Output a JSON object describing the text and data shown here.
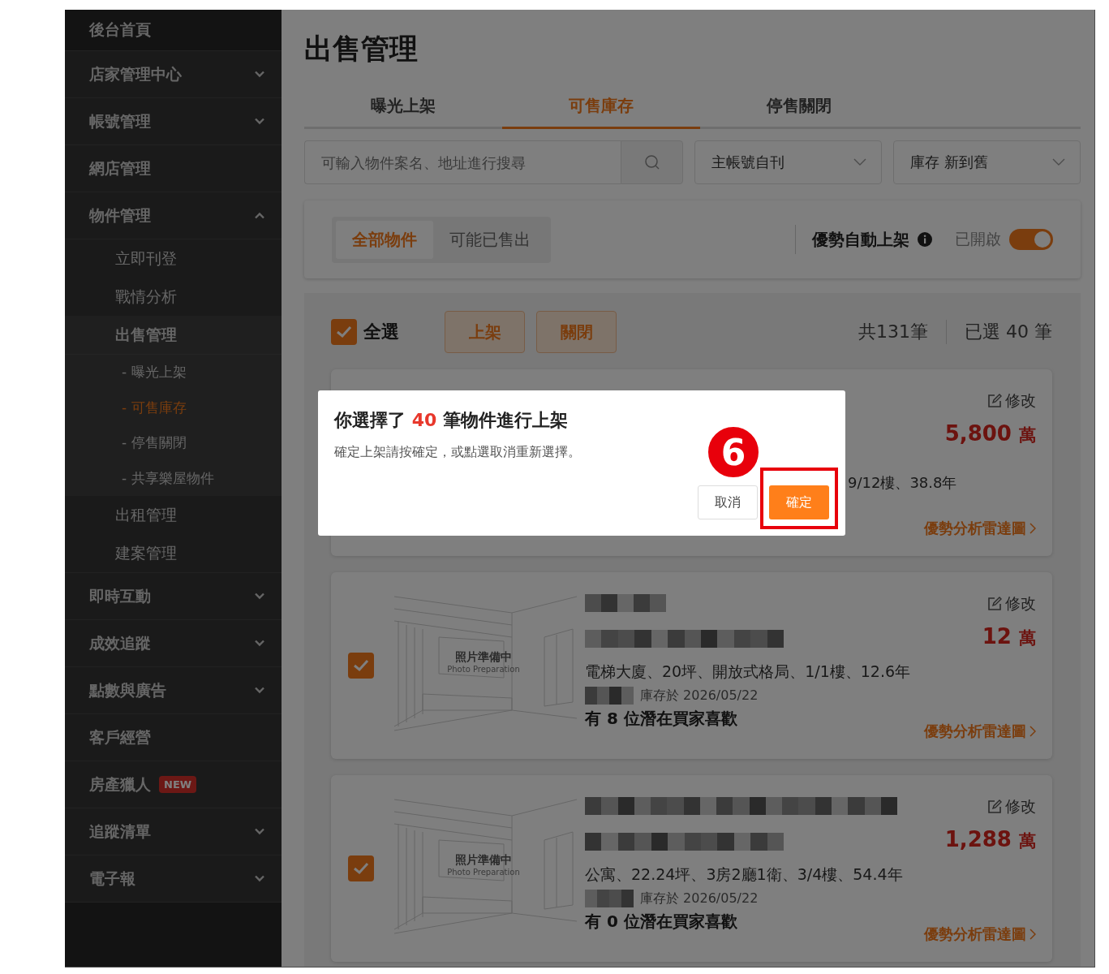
{
  "sidebar": {
    "items": [
      {
        "label": "後台首頁",
        "kind": "home",
        "selected": false
      },
      {
        "label": "店家管理中心",
        "expanded": false,
        "selected": false
      },
      {
        "label": "帳號管理",
        "expanded": false,
        "selected": false
      },
      {
        "label": "網店管理",
        "selected": false
      },
      {
        "label": "物件管理",
        "expanded": true,
        "selected": false,
        "children": [
          {
            "label": "立即刊登",
            "selected": false
          },
          {
            "label": "戰情分析",
            "selected": false
          },
          {
            "label": "出售管理",
            "selected": true,
            "children": [
              {
                "label": "- 曝光上架",
                "selected": false
              },
              {
                "label": "- 可售庫存",
                "selected": true
              },
              {
                "label": "- 停售關閉",
                "selected": false
              },
              {
                "label": "- 共享樂屋物件",
                "selected": false
              }
            ]
          },
          {
            "label": "出租管理",
            "selected": false
          },
          {
            "label": "建案管理",
            "selected": false
          }
        ]
      },
      {
        "label": "即時互動",
        "expanded": false,
        "selected": false
      },
      {
        "label": "成效追蹤",
        "expanded": false,
        "selected": false
      },
      {
        "label": "點數與廣告",
        "expanded": false,
        "selected": false
      },
      {
        "label": "客戶經營",
        "selected": false
      },
      {
        "label": "房產獵人",
        "badge": "NEW",
        "selected": false
      },
      {
        "label": "追蹤清單",
        "expanded": false,
        "selected": false
      },
      {
        "label": "電子報",
        "expanded": false,
        "selected": false
      }
    ]
  },
  "page": {
    "title": "出售管理",
    "tabs": [
      {
        "label": "曝光上架",
        "selected": false
      },
      {
        "label": "可售庫存",
        "selected": true
      },
      {
        "label": "停售關閉",
        "selected": false
      }
    ],
    "search": {
      "placeholder": "可輸入物件案名、地址進行搜尋"
    },
    "selects": [
      {
        "value": "主帳號自刊"
      },
      {
        "value": "庫存 新到舊"
      }
    ],
    "filter": {
      "segments": [
        {
          "label": "全部物件",
          "selected": true
        },
        {
          "label": "可能已售出",
          "selected": false
        }
      ],
      "auto_label": "優勢自動上架",
      "toggle_label": "已開啟",
      "on": true
    },
    "list": {
      "select_all": {
        "label": "全選",
        "checked": true
      },
      "buttons": [
        "上架",
        "關閉"
      ],
      "total": "共131筆",
      "selected_count": "已選 40 筆",
      "cards": [
        {
          "kind": "covered",
          "edit": "修改",
          "price": "5,800",
          "unit": "萬",
          "specs": "9/12樓、38.8年",
          "link": "優勢分析雷達圖"
        },
        {
          "kind": "full",
          "checked": true,
          "photo_title": "照片準備中",
          "photo_subtitle": "Photo Preparation",
          "edit": "修改",
          "price": "12",
          "unit": "萬",
          "specs": "電梯大廈、20坪、開放式格局、1/1樓、12.6年",
          "stock_date": "庫存於 2026/05/22",
          "buyers": "有 8 位潛在買家喜歡",
          "link": "優勢分析雷達圖"
        },
        {
          "kind": "full",
          "checked": true,
          "photo_title": "照片準備中",
          "photo_subtitle": "Photo Preparation",
          "edit": "修改",
          "price": "1,288",
          "unit": "萬",
          "specs": "公寓、22.24坪、3房2廳1衛、3/4樓、54.4年",
          "stock_date": "庫存於 2026/05/22",
          "buyers": "有 0 位潛在買家喜歡",
          "link": "優勢分析雷達圖"
        }
      ]
    }
  },
  "dialog": {
    "title_before": "你選擇了",
    "count": "40",
    "title_after": "筆物件進行上架",
    "message": "確定上架請按確定，或點選取消重新選擇。",
    "cancel": "取消",
    "confirm": "確定"
  },
  "annotation": {
    "number": "6"
  }
}
